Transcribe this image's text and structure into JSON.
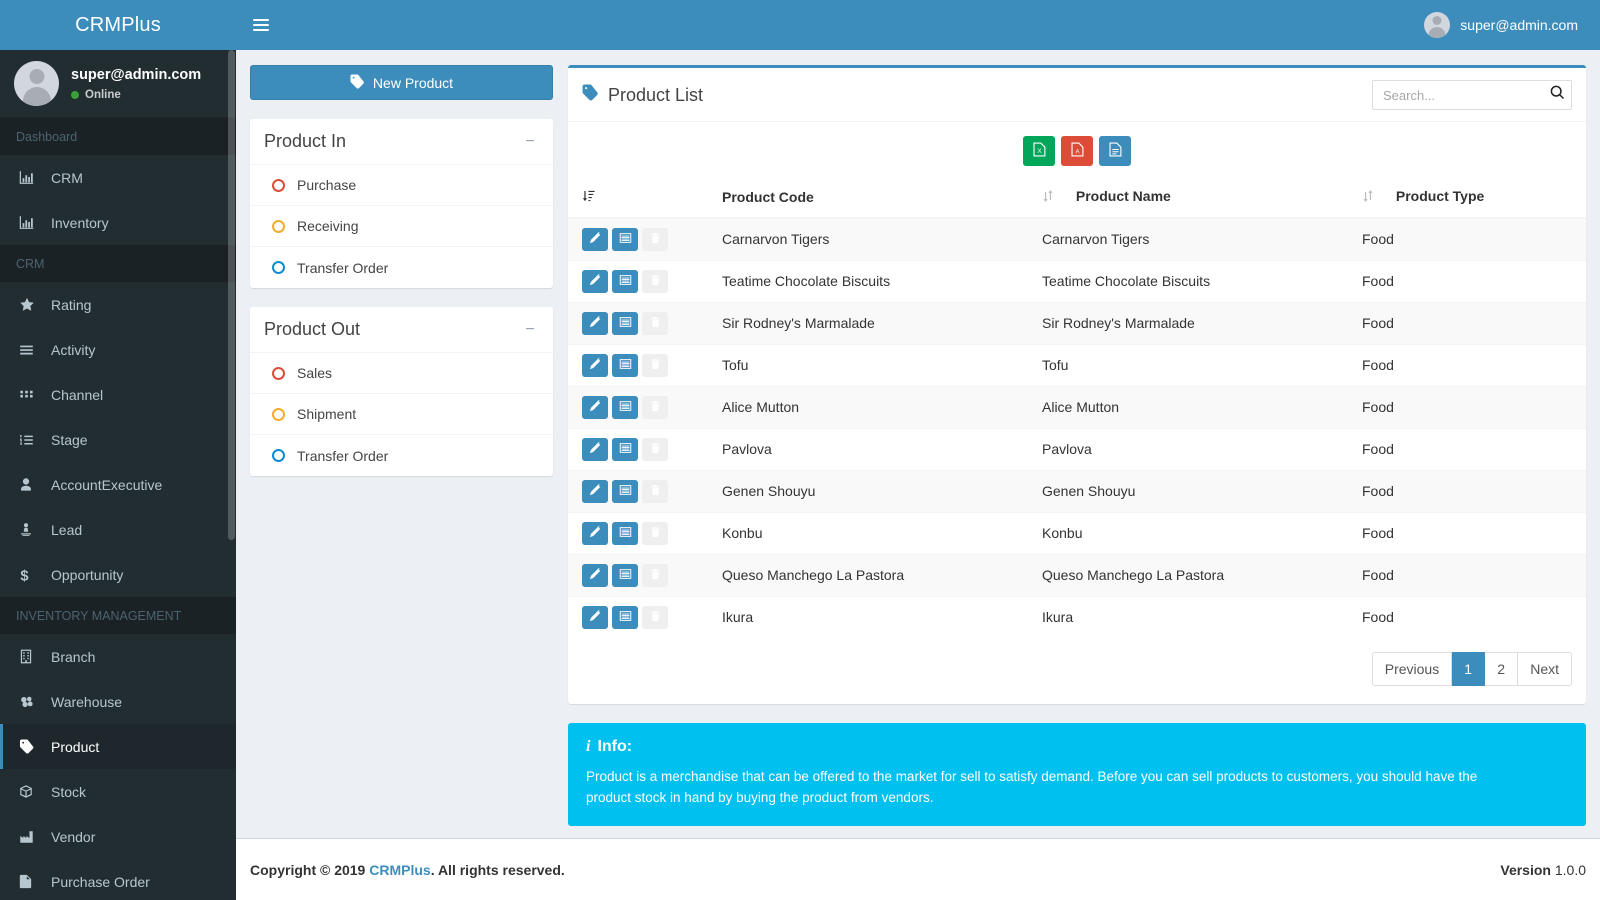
{
  "brand": {
    "name": "CRMPlus"
  },
  "topbar": {
    "menu_icon": "hamburger-icon",
    "user_email": "super@admin.com"
  },
  "sidebar": {
    "user": {
      "name": "super@admin.com",
      "status": "Online"
    },
    "sections": [
      {
        "header": "Dashboard",
        "items": [
          {
            "label": "CRM",
            "icon": "bar-chart-icon",
            "active": false
          },
          {
            "label": "Inventory",
            "icon": "bar-chart-icon",
            "active": false
          }
        ]
      },
      {
        "header": "CRM",
        "items": [
          {
            "label": "Rating",
            "icon": "star-icon",
            "active": false
          },
          {
            "label": "Activity",
            "icon": "bars-icon",
            "active": false
          },
          {
            "label": "Channel",
            "icon": "grid-icon",
            "active": false
          },
          {
            "label": "Stage",
            "icon": "ordered-list-icon",
            "active": false
          },
          {
            "label": "AccountExecutive",
            "icon": "user-icon",
            "active": false
          },
          {
            "label": "Lead",
            "icon": "lead-pin-icon",
            "active": false
          },
          {
            "label": "Opportunity",
            "icon": "dollar-icon",
            "active": false
          }
        ]
      },
      {
        "header": "INVENTORY MANAGEMENT",
        "items": [
          {
            "label": "Branch",
            "icon": "building-icon",
            "active": false
          },
          {
            "label": "Warehouse",
            "icon": "warehouse-icon",
            "active": false
          },
          {
            "label": "Product",
            "icon": "tag-icon",
            "active": true
          },
          {
            "label": "Stock",
            "icon": "cube-icon",
            "active": false
          },
          {
            "label": "Vendor",
            "icon": "factory-icon",
            "active": false
          },
          {
            "label": "Purchase Order",
            "icon": "file-icon",
            "active": false
          }
        ]
      }
    ]
  },
  "left_panel": {
    "new_product_button": {
      "label": "New Product",
      "icon": "tag-icon"
    },
    "boxes": [
      {
        "title": "Product In",
        "collapse_icon": "minus-icon",
        "items": [
          {
            "label": "Purchase",
            "color": "#dd4b39"
          },
          {
            "label": "Receiving",
            "color": "#f0ad2e"
          },
          {
            "label": "Transfer Order",
            "color": "#0d8bd1"
          }
        ]
      },
      {
        "title": "Product Out",
        "collapse_icon": "minus-icon",
        "items": [
          {
            "label": "Sales",
            "color": "#dd4b39"
          },
          {
            "label": "Shipment",
            "color": "#f0ad2e"
          },
          {
            "label": "Transfer Order",
            "color": "#0d8bd1"
          }
        ]
      }
    ]
  },
  "product_list": {
    "title": "Product List",
    "title_icon": "tag-icon",
    "search": {
      "placeholder": "Search...",
      "value": "",
      "icon": "search-icon"
    },
    "export_buttons": [
      {
        "name": "excel",
        "icon": "file-excel-icon",
        "color": "#00a65a"
      },
      {
        "name": "pdf",
        "icon": "file-pdf-icon",
        "color": "#dd4b39"
      },
      {
        "name": "doc",
        "icon": "file-text-icon",
        "color": "#3c8dbc"
      }
    ],
    "row_actions": [
      {
        "name": "edit",
        "icon": "pencil-icon",
        "color": "#3c8dbc"
      },
      {
        "name": "detail",
        "icon": "list-icon",
        "color": "#3c8dbc"
      },
      {
        "name": "delete",
        "icon": "trash-icon",
        "color": "#dd4b39"
      }
    ],
    "columns": [
      "",
      "Product Code",
      "Product Name",
      "Product Type"
    ],
    "rows": [
      {
        "code": "Carnarvon Tigers",
        "name": "Carnarvon Tigers",
        "type": "Food"
      },
      {
        "code": "Teatime Chocolate Biscuits",
        "name": "Teatime Chocolate Biscuits",
        "type": "Food"
      },
      {
        "code": "Sir Rodney's Marmalade",
        "name": "Sir Rodney's Marmalade",
        "type": "Food"
      },
      {
        "code": "Tofu",
        "name": "Tofu",
        "type": "Food"
      },
      {
        "code": "Alice Mutton",
        "name": "Alice Mutton",
        "type": "Food"
      },
      {
        "code": "Pavlova",
        "name": "Pavlova",
        "type": "Food"
      },
      {
        "code": "Genen Shouyu",
        "name": "Genen Shouyu",
        "type": "Food"
      },
      {
        "code": "Konbu",
        "name": "Konbu",
        "type": "Food"
      },
      {
        "code": "Queso Manchego La Pastora",
        "name": "Queso Manchego La Pastora",
        "type": "Food"
      },
      {
        "code": "Ikura",
        "name": "Ikura",
        "type": "Food"
      }
    ],
    "pagination": {
      "previous": "Previous",
      "pages": [
        "1",
        "2"
      ],
      "active_page": "1",
      "next": "Next"
    }
  },
  "info_box": {
    "title": "Info:",
    "icon": "info-icon",
    "text": "Product is a merchandise that can be offered to the market for sell to satisfy demand. Before you can sell products to customers, you should have the product stock in hand by buying the product from vendors.",
    "color": "#00c0ef"
  },
  "footer": {
    "copyright_prefix": "Copyright © 2019 ",
    "brand_link": "CRMPlus",
    "copyright_suffix": ". All rights reserved.",
    "version_label": "Version",
    "version_number": "1.0.0"
  }
}
